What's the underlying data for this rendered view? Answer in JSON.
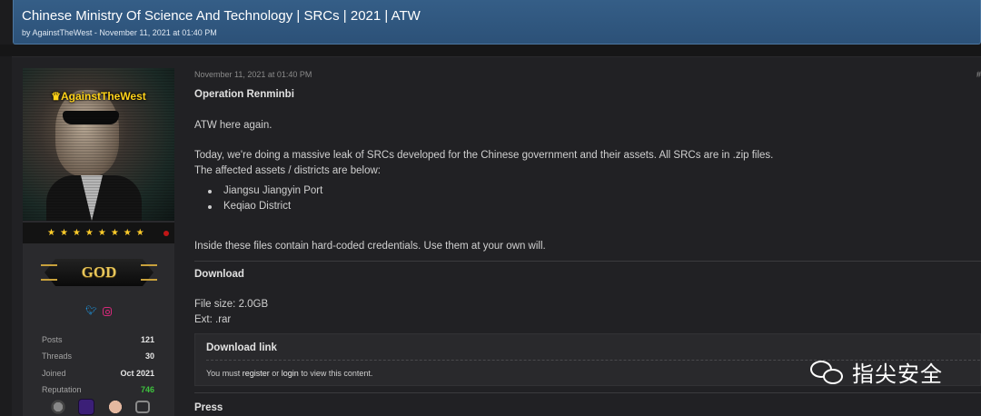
{
  "header": {
    "title": "Chinese Ministry Of Science And Technology | SRCs | 2021 | ATW",
    "byline": "by AgainstTheWest - November 11, 2021 at 01:40 PM"
  },
  "user": {
    "crown_icon": "crown-icon",
    "name": "AgainstTheWest",
    "stars": "★★★★★★★★",
    "rank": "GOD",
    "social_icons": [
      "twitter-icon",
      "instagram-icon"
    ],
    "stats": [
      {
        "label": "Posts",
        "value": "121"
      },
      {
        "label": "Threads",
        "value": "30"
      },
      {
        "label": "Joined",
        "value": "Oct 2021"
      },
      {
        "label": "Reputation",
        "value": "746"
      }
    ],
    "badge_icons": [
      "robot-badge-icon",
      "purple-badge-icon",
      "brain-badge-icon",
      "chat-badge-icon"
    ]
  },
  "post": {
    "date": "November 11, 2021 at 01:40 PM",
    "number": "#",
    "heading": "Operation Renminbi",
    "intro": "ATW here again.",
    "para1": "Today, we're doing a massive leak of SRCs developed for the Chinese government and their assets. All SRCs are in .zip files.",
    "para2": "The affected assets / districts are below:",
    "assets": [
      "Jiangsu Jiangyin Port",
      "Keqiao District"
    ],
    "credentials_note": "Inside these files contain hard-coded credentials. Use them at your own will.",
    "download_heading": "Download",
    "file_size": "File size: 2.0GB",
    "ext": "Ext: .rar",
    "download_box": {
      "title": "Download link",
      "text_prefix": "You must",
      "register": "register",
      "or": "or",
      "login": "login",
      "text_suffix": "to view this content."
    },
    "press_heading": "Press"
  },
  "watermark": {
    "icon": "wechat-icon",
    "text": "指尖安全"
  }
}
